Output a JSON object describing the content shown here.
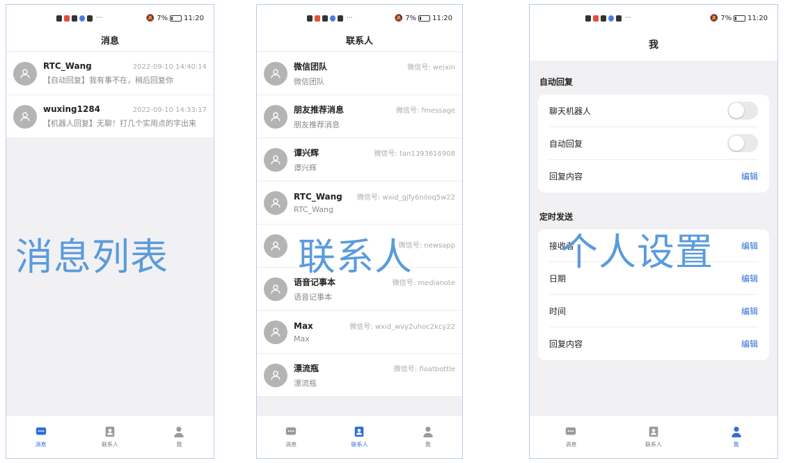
{
  "status_bar": {
    "battery": "7%",
    "time": "11:20"
  },
  "messages_screen": {
    "title": "消息",
    "items": [
      {
        "name": "RTC_Wang",
        "time": "2022-09-10 14:40:14",
        "preview": "【自动回复】我有事不在，稍后回复你"
      },
      {
        "name": "wuxing1284",
        "time": "2022-09-10 14:33:17",
        "preview": "【机器人回复】无聊！打几个实用点的字出来"
      }
    ],
    "overlay": "消息列表"
  },
  "contacts_screen": {
    "title": "联系人",
    "items": [
      {
        "name": "微信团队",
        "id": "微信号: weixin",
        "sub": "微信团队"
      },
      {
        "name": "朋友推荐消息",
        "id": "微信号: fmessage",
        "sub": "朋友推荐消息"
      },
      {
        "name": "谭兴辉",
        "id": "微信号: tan1393616908",
        "sub": "谭兴辉"
      },
      {
        "name": "RTC_Wang",
        "id": "微信号: wxid_gjfy6niloq5w22",
        "sub": "RTC_Wang"
      },
      {
        "name": "",
        "id": "微信号: newsapp",
        "sub": ""
      },
      {
        "name": "语音记事本",
        "id": "微信号: medianote",
        "sub": "语音记事本"
      },
      {
        "name": "Max",
        "id": "微信号: wxid_wvy2uhoc2kcy22",
        "sub": "Max"
      },
      {
        "name": "漂流瓶",
        "id": "微信号: floatbottle",
        "sub": "漂流瓶"
      }
    ],
    "overlay": "联系人"
  },
  "me_screen": {
    "title": "我",
    "auto_reply": {
      "section_title": "自动回复",
      "chatbot_label": "聊天机器人",
      "auto_reply_label": "自动回复",
      "reply_content_label": "回复内容",
      "edit_label": "编辑"
    },
    "scheduled": {
      "section_title": "定时发送",
      "receiver_label": "接收者",
      "date_label": "日期",
      "time_label": "时间",
      "reply_content_label": "回复内容",
      "edit_label": "编辑"
    },
    "overlay": "个人设置"
  },
  "tabs": [
    {
      "label": "消息",
      "icon": "chat-icon"
    },
    {
      "label": "联系人",
      "icon": "contacts-icon"
    },
    {
      "label": "我",
      "icon": "person-icon"
    }
  ],
  "colors": {
    "accent": "#2e6fd9",
    "overlay": "#5a9bdc",
    "inactive_icon": "#9a9a9a"
  }
}
